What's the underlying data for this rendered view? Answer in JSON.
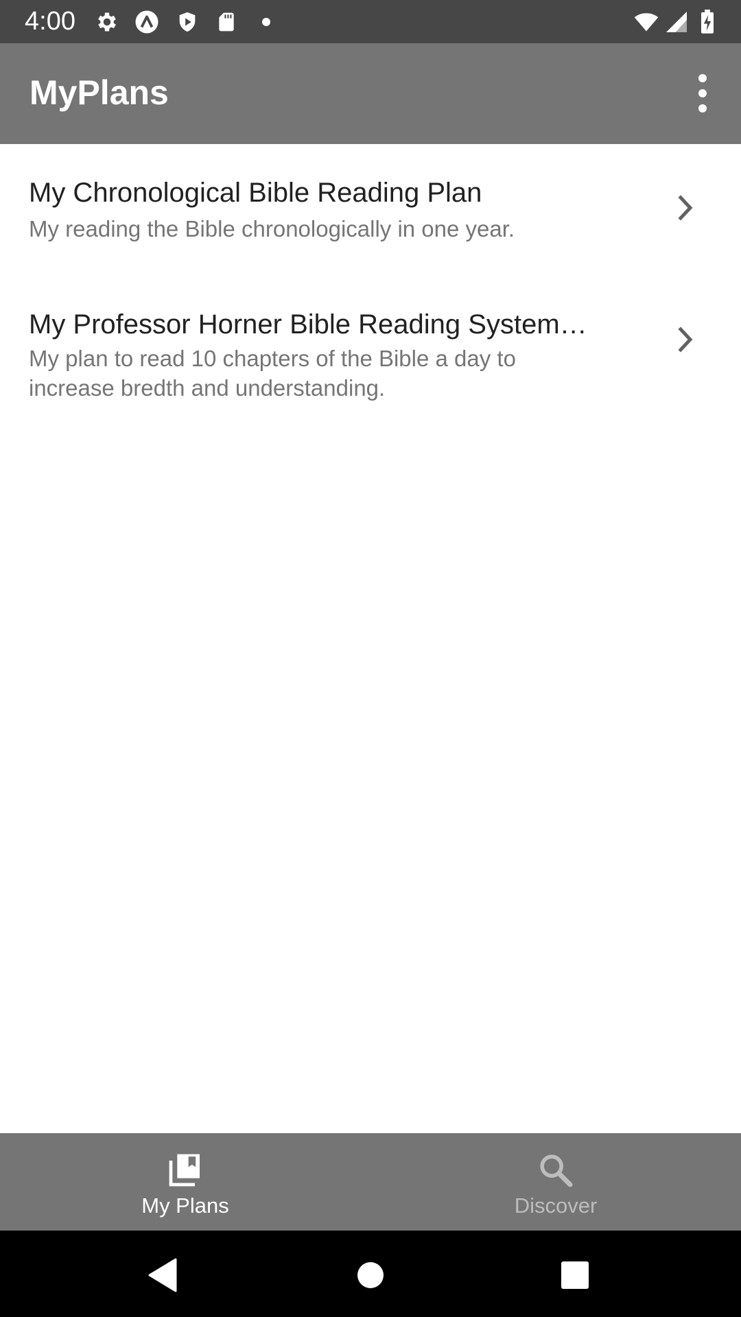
{
  "status_bar": {
    "time": "4:00",
    "left_icons": [
      "gear-icon",
      "app-a-icon",
      "shield-icon",
      "sd-card-icon",
      "dot-icon"
    ],
    "right_icons": [
      "wifi-icon",
      "signal-icon",
      "battery-charging-icon"
    ]
  },
  "app_bar": {
    "title": "MyPlans",
    "overflow_icon": "more-vert-icon"
  },
  "plans": [
    {
      "title": "My Chronological Bible Reading Plan",
      "description": "My reading the Bible chronologically in one year."
    },
    {
      "title": "My Professor Horner Bible Reading System…",
      "description": "My plan to read 10 chapters of the Bible a day to increase bredth and understanding."
    }
  ],
  "bottom_nav": {
    "items": [
      {
        "label": "My Plans",
        "icon": "library-books-icon",
        "selected": true
      },
      {
        "label": "Discover",
        "icon": "search-icon",
        "selected": false
      }
    ]
  },
  "system_nav": {
    "buttons": [
      "back-icon",
      "home-icon",
      "recents-icon"
    ]
  },
  "colors": {
    "status_bar": "#474747",
    "app_bar": "#757575",
    "bottom_nav": "#757575",
    "title_text": "#212121",
    "secondary_text": "#757575",
    "nav_selected": "#ffffff",
    "nav_unselected": "#bdbdbd"
  }
}
